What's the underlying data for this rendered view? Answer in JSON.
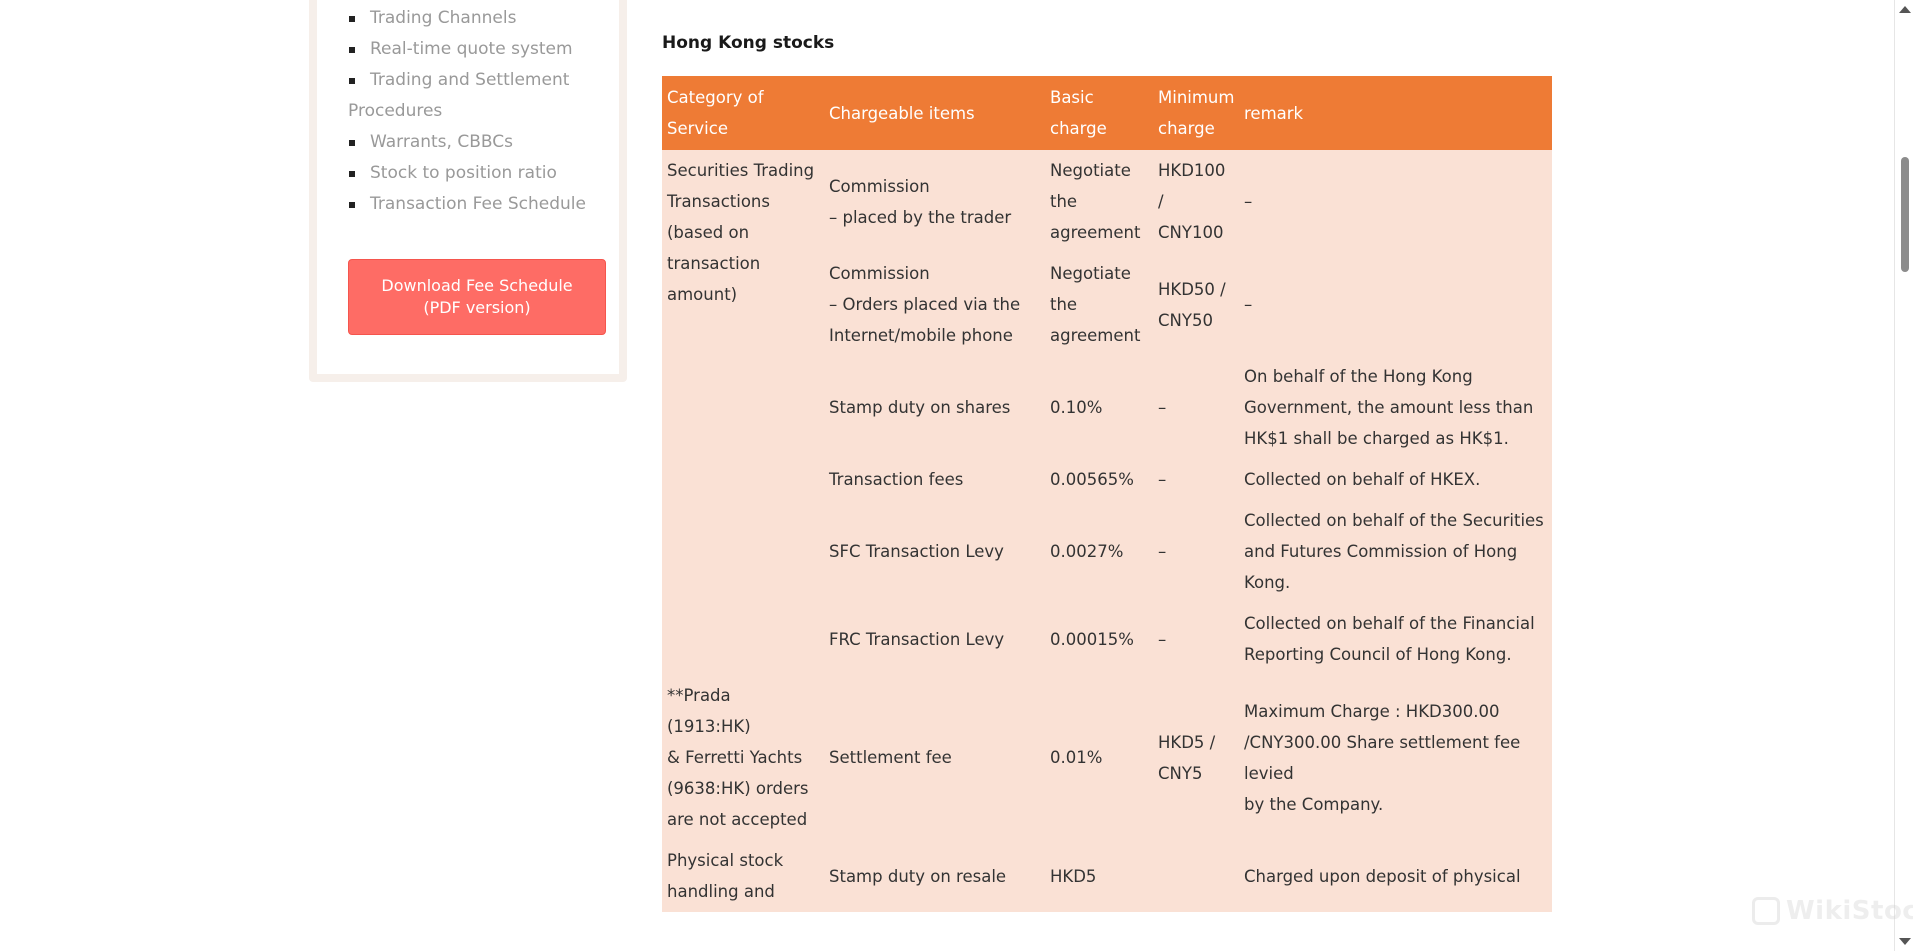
{
  "sidebar": {
    "items": [
      {
        "label": "Trading Channels",
        "bullet": true
      },
      {
        "label": "Real-time quote system",
        "bullet": true
      },
      {
        "label": "Trading and Settlement",
        "bullet": true
      },
      {
        "label": "Procedures",
        "bullet": false
      },
      {
        "label": "Warrants, CBBCs",
        "bullet": true
      },
      {
        "label": "Stock to position ratio",
        "bullet": true
      },
      {
        "label": "Transaction Fee Schedule",
        "bullet": true
      }
    ],
    "download_button": {
      "line1": "Download Fee Schedule",
      "line2": "(PDF version)"
    }
  },
  "main": {
    "section_title": "Hong Kong stocks",
    "table": {
      "headers": {
        "category": "Category of Service",
        "items": "Chargeable items",
        "basic_line1": "Basic",
        "basic_line2": "charge",
        "minimum_line1": "Minimum",
        "minimum_line2": "charge",
        "remark": "remark"
      },
      "rows": [
        {
          "category": [
            "Securities Trading",
            "Transactions",
            "(based on",
            "transaction",
            "amount)"
          ],
          "item": [
            "Commission",
            "– placed by the trader"
          ],
          "basic": [
            "Negotiate",
            "the",
            "agreement"
          ],
          "minimum": [
            "HKD100 /",
            "CNY100"
          ],
          "remark": [
            "–"
          ]
        },
        {
          "category": [],
          "item": [
            "Commission",
            "– Orders placed via the",
            "Internet/mobile phone"
          ],
          "basic": [
            "Negotiate",
            "the",
            "agreement"
          ],
          "minimum": [
            "HKD50 /",
            "CNY50"
          ],
          "remark": [
            "–"
          ]
        },
        {
          "category": [],
          "item": [
            "Stamp duty on shares"
          ],
          "basic": [
            "0.10%"
          ],
          "minimum": [
            "–"
          ],
          "remark": [
            "On behalf of the Hong Kong",
            "Government, the amount less than",
            "HK$1 shall be charged as HK$1."
          ]
        },
        {
          "category": [],
          "item": [
            "Transaction fees"
          ],
          "basic": [
            "0.00565%"
          ],
          "minimum": [
            "–"
          ],
          "remark": [
            "Collected on behalf of HKEX."
          ]
        },
        {
          "category": [],
          "item": [
            "SFC Transaction Levy"
          ],
          "basic": [
            "0.0027%"
          ],
          "minimum": [
            "–"
          ],
          "remark": [
            "Collected on behalf of the Securities",
            "and Futures Commission of Hong",
            "Kong."
          ]
        },
        {
          "category": [],
          "item": [
            "FRC Transaction Levy"
          ],
          "basic": [
            "0.00015%"
          ],
          "minimum": [
            "–"
          ],
          "remark": [
            "Collected on behalf of the Financial",
            "Reporting Council of Hong Kong."
          ]
        },
        {
          "category": [
            "**Prada (1913:HK)",
            "& Ferretti Yachts",
            "(9638:HK) orders",
            "are not accepted"
          ],
          "item": [
            "Settlement fee"
          ],
          "basic": [
            "0.01%"
          ],
          "minimum": [
            "HKD5 /",
            "CNY5"
          ],
          "remark": [
            "Maximum Charge : HKD300.00",
            "/CNY300.00 Share settlement fee",
            "levied",
            "by the Company."
          ]
        },
        {
          "category": [
            "Physical stock",
            "handling and"
          ],
          "item": [
            "Stamp duty on resale"
          ],
          "basic": [
            "HKD5"
          ],
          "minimum": [],
          "remark": [
            "Charged upon deposit of physical"
          ]
        }
      ]
    }
  },
  "watermark": {
    "text": "WikiStock"
  }
}
